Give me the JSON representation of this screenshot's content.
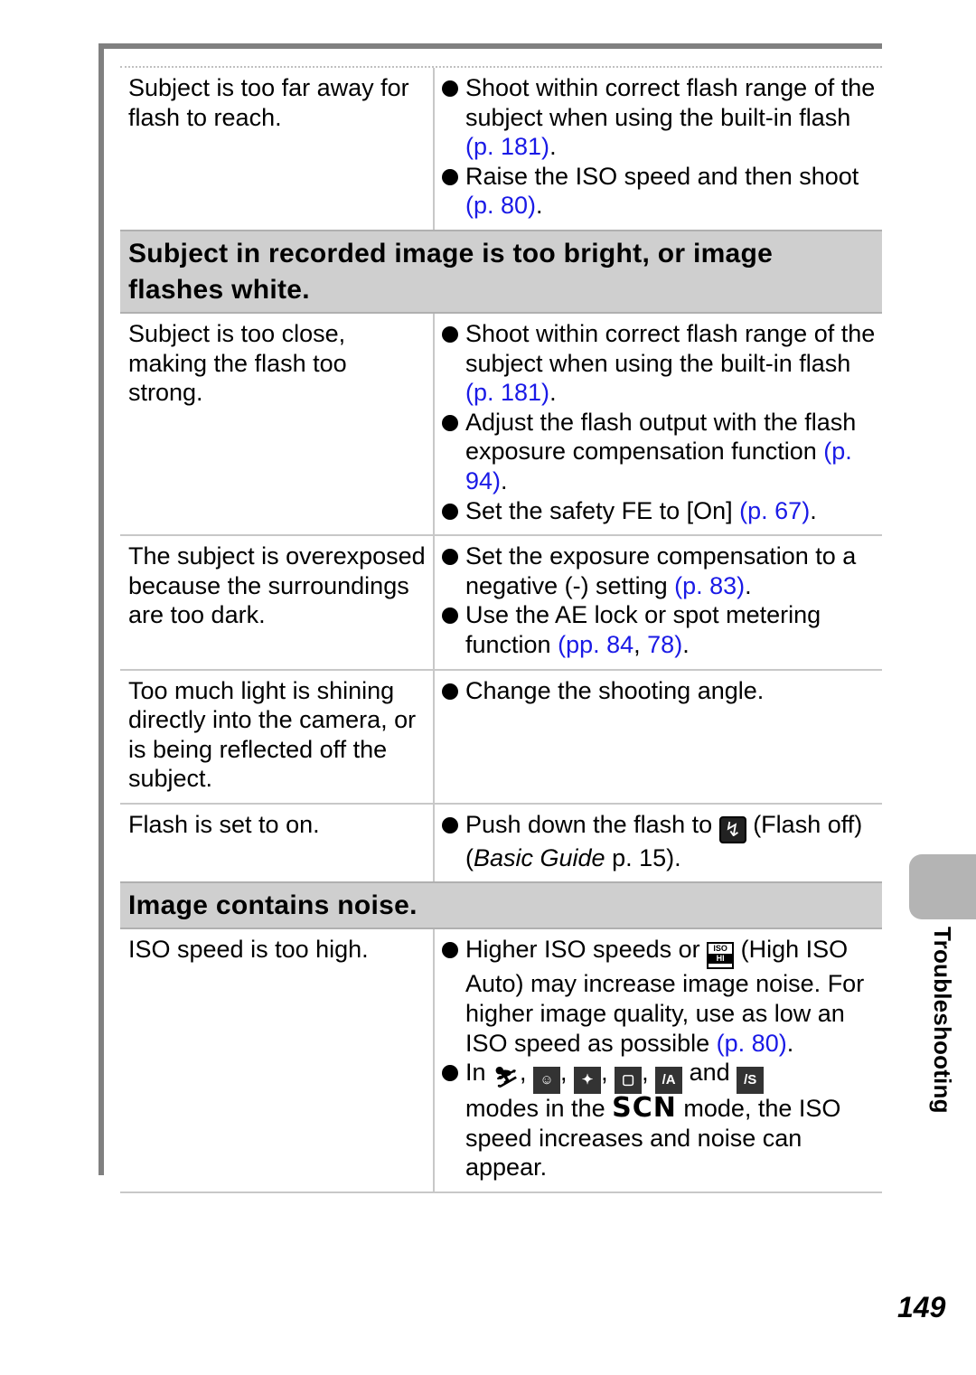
{
  "rows_top": [
    {
      "cause": "Subject is too far away for flash to reach.",
      "fixes": [
        {
          "text": "Shoot within correct flash range of the subject when using the built-in flash ",
          "ref": "(p. 181)",
          "end": "."
        },
        {
          "text": "Raise the ISO speed and then shoot ",
          "ref": "(p. 80)",
          "end": "."
        }
      ]
    }
  ],
  "section_bright": {
    "title": "Subject in recorded image is too bright, or image flashes white.",
    "rows": [
      {
        "cause": "Subject is too close, making the flash too strong.",
        "fixes": [
          {
            "text": "Shoot within correct flash range of the subject when using the built-in flash ",
            "ref": "(p. 181)",
            "end": "."
          },
          {
            "text": "Adjust the flash output with the flash exposure compensation function ",
            "ref": "(p. 94)",
            "end": "."
          },
          {
            "text": "Set the safety FE to [On] ",
            "ref": "(p. 67)",
            "end": "."
          }
        ]
      },
      {
        "cause": "The subject is overexposed because the surroundings are too dark.",
        "fixes": [
          {
            "text": "Set the exposure compensation to a negative (-) setting ",
            "ref": "(p. 83)",
            "end": "."
          },
          {
            "text": "Use the AE lock or spot metering function ",
            "ref": "(pp. 84",
            "ref_sep": ", ",
            "ref2": "78)",
            "end": "."
          }
        ]
      },
      {
        "cause": "Too much light is shining directly into the camera, or is being reflected off the subject.",
        "fixes": [
          {
            "text": "Change the shooting angle."
          }
        ]
      },
      {
        "cause": "Flash is set to on.",
        "fixes": [
          {
            "text": "Push down the flash to ",
            "icon": "flash-off-icon",
            "text2": " (Flash off) (",
            "italic": "Basic Guide",
            "text3": " p. 15)."
          }
        ]
      }
    ]
  },
  "section_noise": {
    "title": "Image contains noise.",
    "rows": [
      {
        "cause": "ISO speed is too high.",
        "fix1": {
          "text": "Higher ISO speeds or ",
          "icon_top": "ISO",
          "icon_bottom": "HI",
          "text2": " (High ISO Auto) may increase image noise. For higher image quality, use as low an ISO speed as possible ",
          "ref": "(p. 80)",
          "end": "."
        },
        "fix2": {
          "prefix": "In ",
          "sep": ", ",
          "and": " and ",
          "modes_label": "SCN",
          "text_a": "modes in the ",
          "text_b": " mode, the ISO speed increases and noise can appear."
        }
      }
    ]
  },
  "side_tab": {
    "label": "Troubleshooting"
  },
  "page_number": "149",
  "colors": {
    "link": "#1a1ae6",
    "header_bg": "#cfcfcf",
    "frame": "#808080"
  }
}
